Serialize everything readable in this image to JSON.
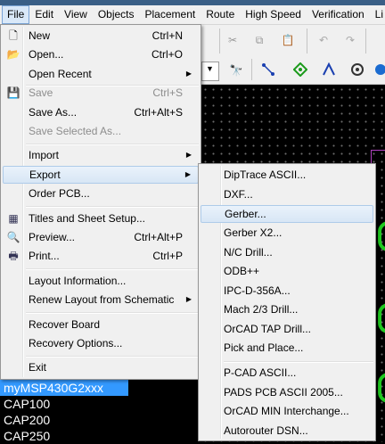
{
  "menubar": [
    "File",
    "Edit",
    "View",
    "Objects",
    "Placement",
    "Route",
    "High Speed",
    "Verification",
    "Li"
  ],
  "file_menu": [
    {
      "label": "New",
      "shortcut": "Ctrl+N",
      "icon": "new-file-icon",
      "enabled": true
    },
    {
      "label": "Open...",
      "shortcut": "Ctrl+O",
      "icon": "open-folder-icon",
      "enabled": true
    },
    {
      "label": "Open Recent",
      "shortcut": "",
      "icon": "",
      "enabled": true,
      "submenu": true
    },
    {
      "label": "Save",
      "shortcut": "Ctrl+S",
      "icon": "save-icon",
      "enabled": false
    },
    {
      "label": "Save As...",
      "shortcut": "Ctrl+Alt+S",
      "icon": "",
      "enabled": true
    },
    {
      "label": "Save Selected As...",
      "shortcut": "",
      "icon": "",
      "enabled": false
    },
    {
      "label": "Import",
      "shortcut": "",
      "icon": "",
      "enabled": true,
      "submenu": true
    },
    {
      "label": "Export",
      "shortcut": "",
      "icon": "",
      "enabled": true,
      "submenu": true,
      "highlighted": true
    },
    {
      "label": "Order PCB...",
      "shortcut": "",
      "icon": "",
      "enabled": true
    },
    {
      "label": "Titles and Sheet Setup...",
      "shortcut": "",
      "icon": "sheet-setup-icon",
      "enabled": true
    },
    {
      "label": "Preview...",
      "shortcut": "Ctrl+Alt+P",
      "icon": "print-preview-icon",
      "enabled": true
    },
    {
      "label": "Print...",
      "shortcut": "Ctrl+P",
      "icon": "printer-icon",
      "enabled": true
    },
    {
      "label": "Layout Information...",
      "shortcut": "",
      "icon": "",
      "enabled": true
    },
    {
      "label": "Renew Layout from Schematic",
      "shortcut": "",
      "icon": "",
      "enabled": true,
      "submenu": true
    },
    {
      "label": "Recover Board",
      "shortcut": "",
      "icon": "",
      "enabled": true
    },
    {
      "label": "Recovery Options...",
      "shortcut": "",
      "icon": "",
      "enabled": true
    },
    {
      "label": "Exit",
      "shortcut": "",
      "icon": "",
      "enabled": true
    }
  ],
  "export_menu": [
    {
      "label": "DipTrace ASCII..."
    },
    {
      "label": "DXF..."
    },
    {
      "label": "Gerber...",
      "highlighted": true
    },
    {
      "label": "Gerber X2..."
    },
    {
      "label": "N/C Drill..."
    },
    {
      "label": "ODB++"
    },
    {
      "label": "IPC-D-356A..."
    },
    {
      "label": "Mach 2/3 Drill..."
    },
    {
      "label": "OrCAD TAP Drill..."
    },
    {
      "label": "Pick and Place..."
    },
    {
      "label": "P-CAD ASCII..."
    },
    {
      "label": "PADS PCB ASCII 2005..."
    },
    {
      "label": "OrCAD MIN Interchange..."
    },
    {
      "label": "Autorouter DSN..."
    }
  ],
  "component_list": [
    "myMSP430G2xxx",
    "CAP100",
    "CAP200",
    "CAP250"
  ],
  "toolbar_icons": [
    "cut-icon",
    "copy-icon",
    "paste-icon",
    "undo-icon",
    "redo-icon",
    "find-icon",
    "route-icon",
    "via-icon",
    "arc-icon",
    "pad-icon",
    "zoom-icon"
  ],
  "colors": {
    "selection": "#3399ff",
    "board_outline": "#b040c0",
    "pad": "#1fc91f"
  }
}
